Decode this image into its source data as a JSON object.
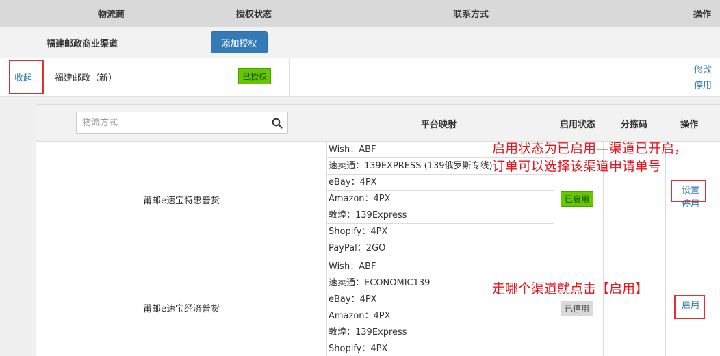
{
  "header": {
    "carrier": "物流商",
    "auth_status": "授权状态",
    "contact": "联系方式",
    "actions": "操作"
  },
  "carrier_row": {
    "name": "福建邮政商业渠道",
    "add_auth_button": "添加授权"
  },
  "account_row": {
    "collapse_link": "收起",
    "account_name": "福建邮政（新）",
    "auth_badge": "已授权",
    "edit_link": "修改",
    "disable_link": "停用"
  },
  "channel_table": {
    "search_placeholder": "物流方式",
    "platform_mapping_header": "平台映射",
    "status_header": "启用状态",
    "sort_code_header": "分拣码",
    "actions_header": "操作",
    "rows": [
      {
        "name": "莆邮e速宝特惠普货",
        "mappings": [
          "Wish：ABF",
          "速卖通：139EXPRESS (139俄罗斯专线)",
          "eBay：4PX",
          "Amazon：4PX",
          "敦煌：139Express",
          "Shopify：4PX",
          "PayPal：2GO"
        ],
        "status": "已启用",
        "action_primary": "设置",
        "action_secondary": "停用"
      },
      {
        "name": "莆邮e速宝经济普货",
        "mappings": [
          "Wish：ABF",
          "速卖通：ECONOMIC139",
          "eBay：4PX",
          "Amazon：4PX",
          "敦煌：139Express",
          "Shopify：4PX"
        ],
        "status": "已停用",
        "action_primary": "启用"
      }
    ]
  },
  "annotations": {
    "note1_line1": "启用状态为已启用—渠道已开启，",
    "note1_line2": "订单可以选择该渠道申请单号",
    "note2": "走哪个渠道就点击【启用】"
  },
  "colors": {
    "header_bg": "#d9d9d9",
    "primary_button": "#337ab7",
    "enabled_badge": "#64c800",
    "disabled_badge": "#d9d9d9",
    "link": "#337ab7",
    "annotation_red": "#e8141c"
  }
}
